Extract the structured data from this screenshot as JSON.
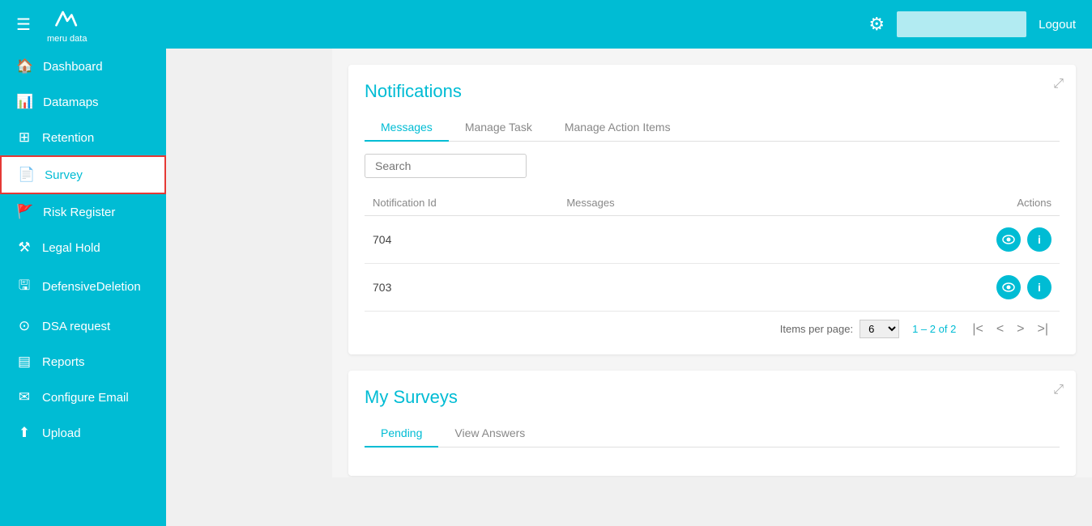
{
  "header": {
    "hamburger": "☰",
    "logo_alt": "meru data",
    "gear": "⚙",
    "logout_label": "Logout"
  },
  "sidebar": {
    "items": [
      {
        "id": "dashboard",
        "label": "Dashboard",
        "icon": "🏠"
      },
      {
        "id": "datamaps",
        "label": "Datamaps",
        "icon": "📊"
      },
      {
        "id": "retention",
        "label": "Retention",
        "icon": "⊞"
      },
      {
        "id": "survey",
        "label": "Survey",
        "icon": "📄",
        "active": true
      },
      {
        "id": "risk-register",
        "label": "Risk Register",
        "icon": "🚩"
      },
      {
        "id": "legal-hold",
        "label": "Legal Hold",
        "icon": "⚒"
      },
      {
        "id": "defensive-deletion",
        "label": "DefensiveDeletion",
        "icon": "🖫"
      },
      {
        "id": "dsa-request",
        "label": "DSA request",
        "icon": "⊙"
      },
      {
        "id": "reports",
        "label": "Reports",
        "icon": "▤"
      },
      {
        "id": "configure-email",
        "label": "Configure Email",
        "icon": "✉"
      },
      {
        "id": "upload",
        "label": "Upload",
        "icon": "⬆"
      }
    ]
  },
  "notifications": {
    "title": "Notifications",
    "tabs": [
      {
        "id": "messages",
        "label": "Messages",
        "active": true
      },
      {
        "id": "manage-task",
        "label": "Manage Task",
        "active": false
      },
      {
        "id": "manage-action-items",
        "label": "Manage Action Items",
        "active": false
      }
    ],
    "search_placeholder": "Search",
    "table": {
      "columns": [
        {
          "id": "notification-id",
          "label": "Notification Id"
        },
        {
          "id": "messages",
          "label": "Messages"
        },
        {
          "id": "actions",
          "label": "Actions"
        }
      ],
      "rows": [
        {
          "id": "704",
          "notification_id": "704",
          "messages": ""
        },
        {
          "id": "703",
          "notification_id": "703",
          "messages": ""
        }
      ]
    },
    "pagination": {
      "items_per_page_label": "Items per page:",
      "items_per_page": "6",
      "range": "1 – 2 of 2"
    }
  },
  "my_surveys": {
    "title": "My Surveys",
    "tabs": [
      {
        "id": "pending",
        "label": "Pending",
        "active": true
      },
      {
        "id": "view-answers",
        "label": "View Answers",
        "active": false
      }
    ]
  }
}
